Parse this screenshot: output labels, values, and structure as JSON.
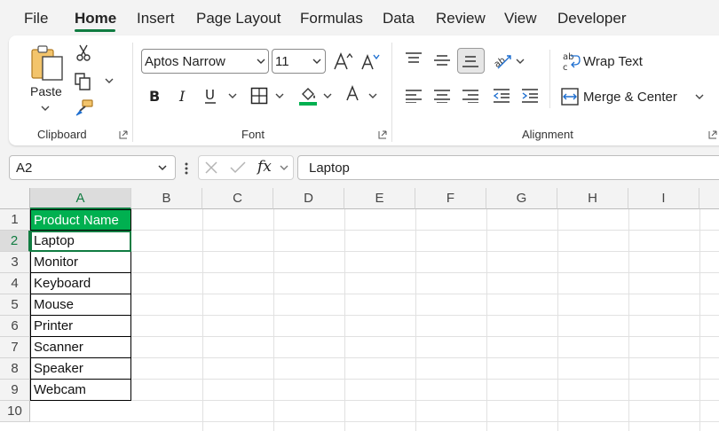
{
  "menu": {
    "tabs": [
      {
        "label": "File",
        "active": false
      },
      {
        "label": "Home",
        "active": true
      },
      {
        "label": "Insert",
        "active": false
      },
      {
        "label": "Page Layout",
        "active": false
      },
      {
        "label": "Formulas",
        "active": false
      },
      {
        "label": "Data",
        "active": false
      },
      {
        "label": "Review",
        "active": false
      },
      {
        "label": "View",
        "active": false
      },
      {
        "label": "Developer",
        "active": false
      }
    ]
  },
  "ribbon": {
    "clipboard": {
      "paste_label": "Paste",
      "group_label": "Clipboard"
    },
    "font": {
      "font_name": "Aptos Narrow",
      "font_size": "11",
      "group_label": "Font"
    },
    "alignment": {
      "wrap_text": "Wrap Text",
      "merge_center": "Merge & Center",
      "group_label": "Alignment"
    }
  },
  "formula_bar": {
    "name_box": "A2",
    "fx_label": "fx",
    "formula": "Laptop"
  },
  "sheet": {
    "columns": [
      "A",
      "B",
      "C",
      "D",
      "E",
      "F",
      "G",
      "H",
      "I"
    ],
    "selected_column": "A",
    "rows": [
      "1",
      "2",
      "3",
      "4",
      "5",
      "6",
      "7",
      "8",
      "9",
      "10"
    ],
    "selected_row": "2",
    "cells": [
      "Product Name",
      "Laptop",
      "Monitor",
      "Keyboard",
      "Mouse",
      "Printer",
      "Scanner",
      "Speaker",
      "Webcam"
    ]
  },
  "colors": {
    "accent": "#107c41",
    "header_fill": "#00b050",
    "header_text": "#ffffff"
  }
}
